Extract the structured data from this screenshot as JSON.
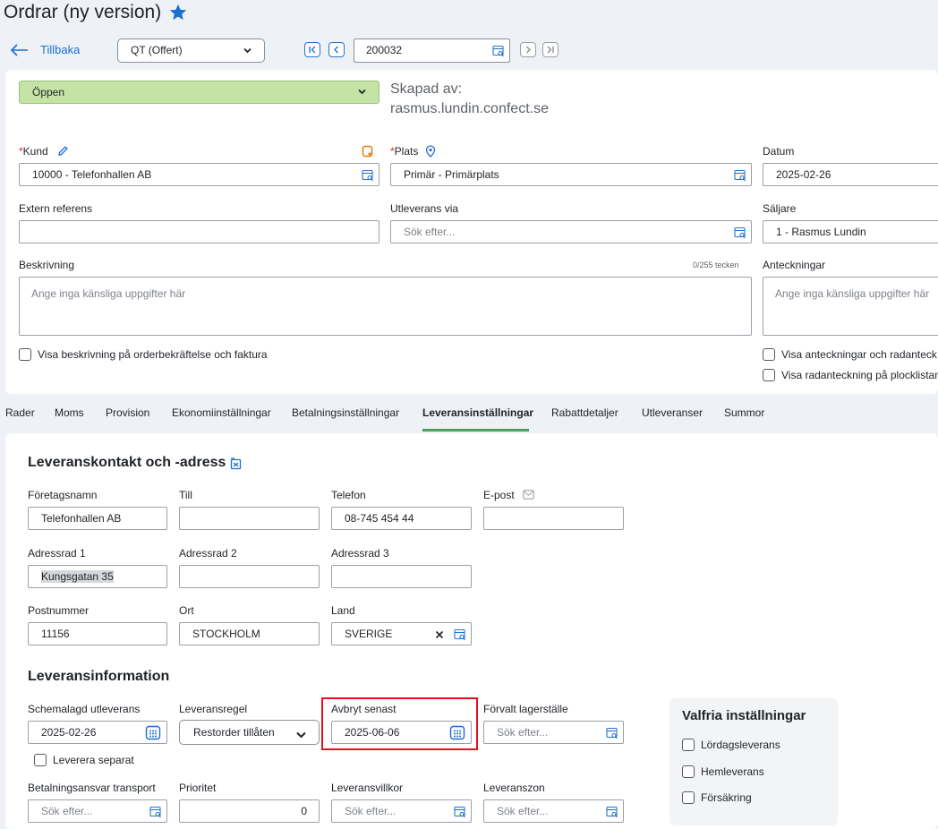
{
  "page": {
    "title": "Ordrar (ny version)"
  },
  "topbar": {
    "back_label": "Tillbaka",
    "order_type": "QT (Offert)",
    "order_number": "200032"
  },
  "header": {
    "status": "Öppen",
    "created_label": "Skapad av:",
    "created_by": "rasmus.lundin.confect.se"
  },
  "fields": {
    "customer_label": "Kund",
    "customer_value": "10000 - Telefonhallen AB",
    "site_label": "Plats",
    "site_value": "Primär - Primärplats",
    "date_label": "Datum",
    "date_value": "2025-02-26",
    "extref_label": "Extern referens",
    "extref_value": "",
    "shipvia_label": "Utleverans via",
    "shipvia_placeholder": "Sök efter...",
    "salesperson_label": "Säljare",
    "salesperson_value": "1 - Rasmus Lundin",
    "description_label": "Beskrivning",
    "description_counter": "0/255 tecken",
    "description_placeholder": "Ange inga känsliga uppgifter här",
    "notes_label": "Anteckningar",
    "notes_placeholder": "Ange inga känsliga uppgifter här",
    "cb_show_description": "Visa beskrivning på orderbekräftelse och faktura",
    "cb_show_notes": "Visa anteckningar och radanteck",
    "cb_show_linenote": "Visa radanteckning på plocklistan"
  },
  "tabs": [
    "Rader",
    "Moms",
    "Provision",
    "Ekonomiinställningar",
    "Betalningsinställningar",
    "Leveransinställningar",
    "Rabattdetaljer",
    "Utleveranser",
    "Summor"
  ],
  "contact": {
    "heading": "Leveranskontakt och -adress",
    "company_label": "Företagsnamn",
    "company_value": "Telefonhallen AB",
    "to_label": "Till",
    "to_value": "",
    "phone_label": "Telefon",
    "phone_value": "08-745 454 44",
    "email_label": "E-post",
    "email_value": "",
    "addr1_label": "Adressrad 1",
    "addr1_value": "Kungsgatan 35",
    "addr2_label": "Adressrad 2",
    "addr2_value": "",
    "addr3_label": "Adressrad 3",
    "addr3_value": "",
    "zip_label": "Postnummer",
    "zip_value": "11156",
    "city_label": "Ort",
    "city_value": "STOCKHOLM",
    "country_label": "Land",
    "country_value": "SVERIGE"
  },
  "delivery": {
    "heading": "Leveransinformation",
    "scheduled_label": "Schemalagd utleverans",
    "scheduled_value": "2025-02-26",
    "rule_label": "Leveransregel",
    "rule_value": "Restorder tillåten",
    "cancel_label": "Avbryt senast",
    "cancel_value": "2025-06-06",
    "warehouse_label": "Förvalt lagerställe",
    "warehouse_placeholder": "Sök efter...",
    "separate_label": "Leverera separat",
    "transport_label": "Betalningsansvar transport",
    "transport_placeholder": "Sök efter...",
    "priority_label": "Prioritet",
    "priority_value": "0",
    "terms_label": "Leveransvillkor",
    "terms_placeholder": "Sök efter...",
    "zone_label": "Leveranszon",
    "zone_placeholder": "Sök efter..."
  },
  "optional": {
    "heading": "Valfria inställningar",
    "saturday": "Lördagsleverans",
    "home": "Hemleverans",
    "insurance": "Försäkring"
  },
  "colors": {
    "accent": "#1b6fd1",
    "status_green": "#c6e3a6",
    "tab_active": "#4aa05a",
    "highlight": "#e3121b"
  }
}
